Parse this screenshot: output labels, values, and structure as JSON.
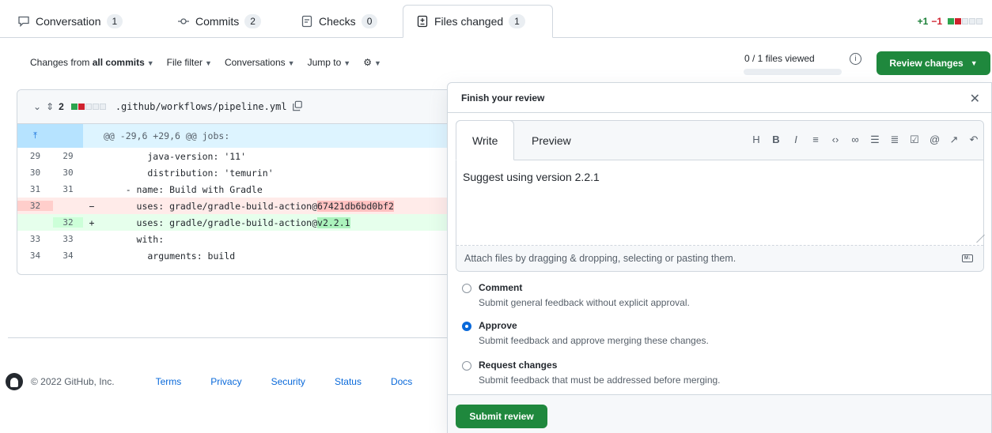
{
  "tabs": [
    {
      "label": "Conversation",
      "count": "1",
      "icon": "comment-icon"
    },
    {
      "label": "Commits",
      "count": "2",
      "icon": "commit-icon"
    },
    {
      "label": "Checks",
      "count": "0",
      "icon": "checklist-icon"
    },
    {
      "label": "Files changed",
      "count": "1",
      "icon": "file-diff-icon"
    }
  ],
  "diffstat": {
    "additions": "+1",
    "deletions": "−1"
  },
  "toolbar": {
    "changes_prefix": "Changes from",
    "changes_value": "all commits",
    "file_filter": "File filter",
    "conversations": "Conversations",
    "jump_to": "Jump to"
  },
  "files_viewed": {
    "label": "0 / 1 files viewed",
    "viewed": 0,
    "total": 1
  },
  "review_button": "Review changes",
  "file": {
    "changes": "2",
    "name": ".github/workflows/pipeline.yml",
    "hunk": "@@ -29,6 +29,6 @@ jobs:",
    "lines": [
      {
        "old": "29",
        "new": "29",
        "sign": "",
        "code": "        java-version: '11'"
      },
      {
        "old": "30",
        "new": "30",
        "sign": "",
        "code": "        distribution: 'temurin'"
      },
      {
        "old": "31",
        "new": "31",
        "sign": "",
        "code": "    - name: Build with Gradle"
      },
      {
        "old": "32",
        "new": "",
        "sign": "−",
        "code": "      uses: gradle/gradle-build-action@",
        "highlight": "67421db6bd0bf2"
      },
      {
        "old": "",
        "new": "32",
        "sign": "+",
        "code": "      uses: gradle/gradle-build-action@",
        "highlight": "v2.2.1"
      },
      {
        "old": "33",
        "new": "33",
        "sign": "",
        "code": "      with:"
      },
      {
        "old": "34",
        "new": "34",
        "sign": "",
        "code": "        arguments: build"
      }
    ]
  },
  "footer": {
    "copyright": "© 2022 GitHub, Inc.",
    "links": [
      "Terms",
      "Privacy",
      "Security",
      "Status",
      "Docs"
    ]
  },
  "review": {
    "title": "Finish your review",
    "tab_write": "Write",
    "tab_preview": "Preview",
    "body": "Suggest using version 2.2.1",
    "attach_hint": "Attach files by dragging & dropping, selecting or pasting them.",
    "options": [
      {
        "title": "Comment",
        "desc": "Submit general feedback without explicit approval.",
        "selected": false
      },
      {
        "title": "Approve",
        "desc": "Submit feedback and approve merging these changes.",
        "selected": true
      },
      {
        "title": "Request changes",
        "desc": "Submit feedback that must be addressed before merging.",
        "selected": false
      }
    ],
    "submit": "Submit review"
  },
  "colors": {
    "accent_green": "#1f883d",
    "link_blue": "#0969da",
    "deletion_red": "#cf222e"
  }
}
